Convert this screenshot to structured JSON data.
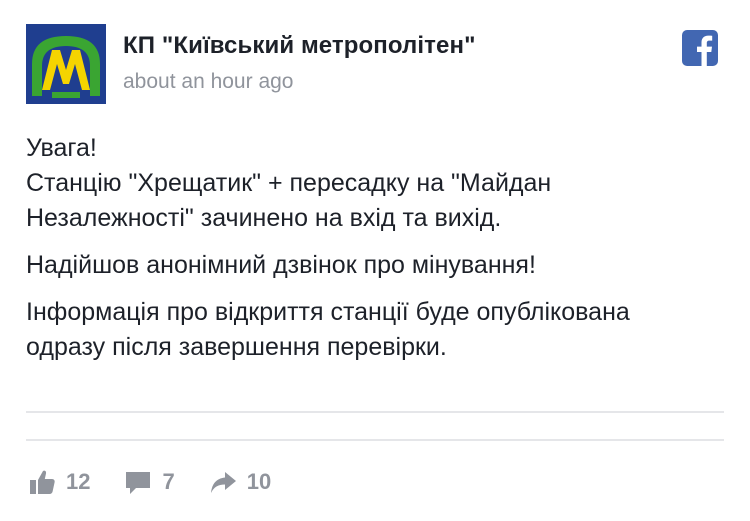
{
  "post": {
    "page_name": "КП \"Київський метрополітен\"",
    "timestamp": "about an hour ago",
    "avatar_icon": "kyiv-metro-logo-icon",
    "platform_icon": "facebook-icon",
    "paragraphs": [
      {
        "line1": "Увага!",
        "line2": "Станцію \"Хрещатик\" + пересадку на \"Майдан",
        "line3": "Незалежності\" зачинено на вхід та вихід."
      },
      {
        "line1": "Надійшов анонімний дзвінок про мінування!"
      },
      {
        "line1": "Інформація про відкриття станції буде опублікована",
        "line2": "одразу після завершення перевірки."
      }
    ],
    "actions": {
      "likes": "12",
      "comments": "7",
      "shares": "10"
    }
  },
  "colors": {
    "metro_blue": "#1f3e8f",
    "metro_yellow": "#f5d400",
    "metro_green": "#3aa532",
    "facebook_blue": "#4267b2",
    "muted_gray": "#90949c"
  }
}
